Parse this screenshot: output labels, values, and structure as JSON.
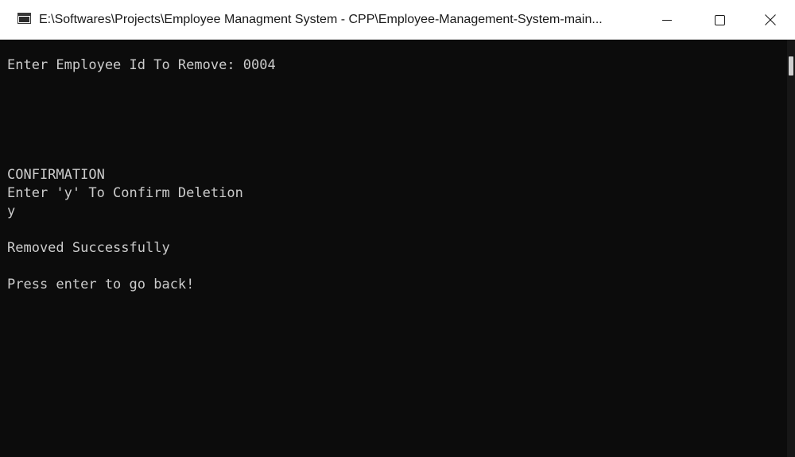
{
  "window": {
    "title": "E:\\Softwares\\Projects\\Employee Managment System - CPP\\Employee-Management-System-main...",
    "controls": {
      "minimize_icon": "minimize-icon",
      "maximize_icon": "maximize-icon",
      "close_icon": "close-icon"
    }
  },
  "console": {
    "lines": [
      "Enter Employee Id To Remove: 0004",
      "CONFIRMATION",
      "Enter 'y' To Confirm Deletion",
      "y",
      "Removed Successfully",
      "Press enter to go back!"
    ],
    "background_color": "#0c0c0c",
    "text_color": "#cccccc"
  }
}
